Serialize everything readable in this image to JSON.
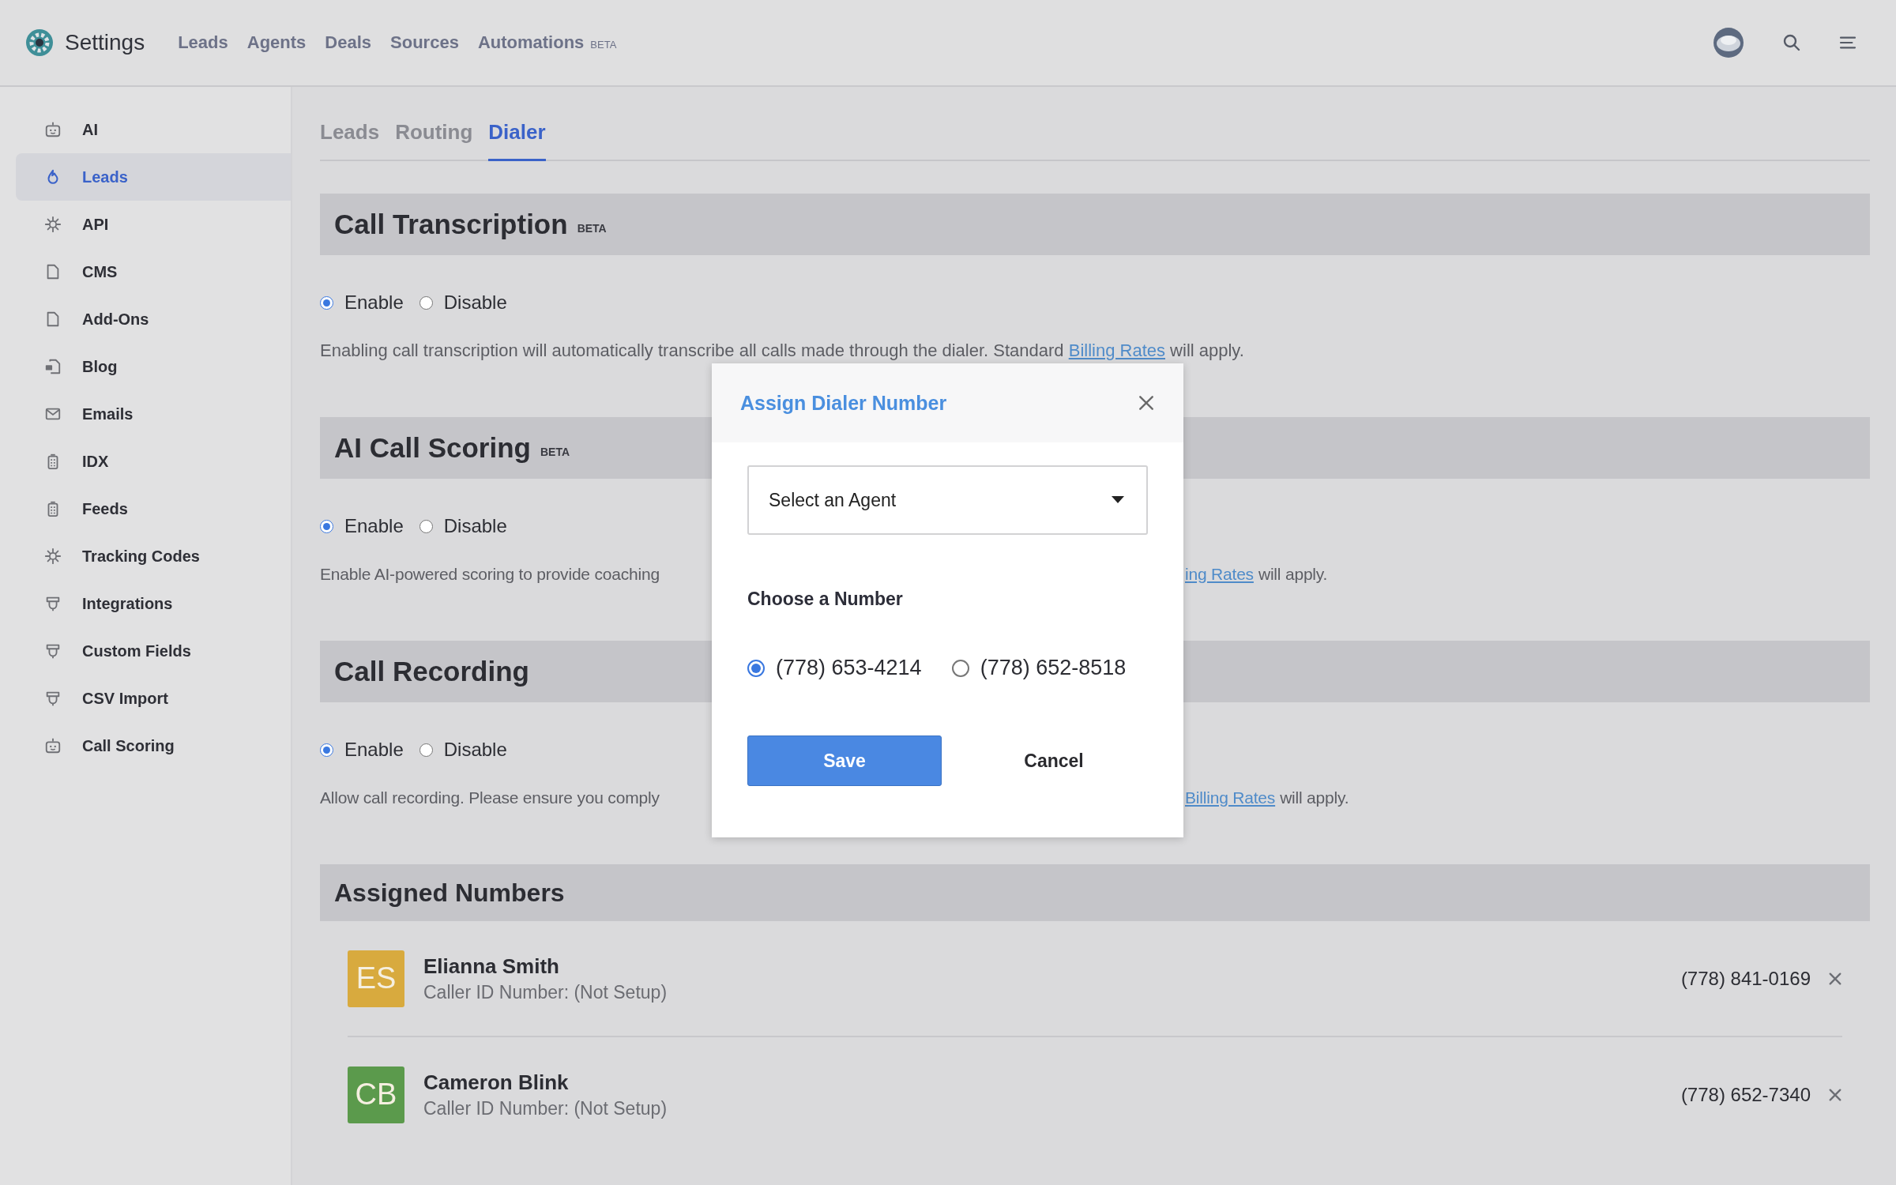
{
  "app": {
    "title": "Settings"
  },
  "nav": [
    {
      "label": "Leads"
    },
    {
      "label": "Agents"
    },
    {
      "label": "Deals"
    },
    {
      "label": "Sources"
    },
    {
      "label": "Automations",
      "badge": "BETA"
    }
  ],
  "sidebar": {
    "items": [
      {
        "label": "AI",
        "kind": "robot",
        "selected": false
      },
      {
        "label": "Leads",
        "kind": "flame",
        "selected": true
      },
      {
        "label": "API",
        "kind": "gear",
        "selected": false
      },
      {
        "label": "CMS",
        "kind": "page",
        "selected": false
      },
      {
        "label": "Add-Ons",
        "kind": "page",
        "selected": false
      },
      {
        "label": "Blog",
        "kind": "chat",
        "selected": false
      },
      {
        "label": "Emails",
        "kind": "mail",
        "selected": false
      },
      {
        "label": "IDX",
        "kind": "building",
        "selected": false
      },
      {
        "label": "Feeds",
        "kind": "building",
        "selected": false
      },
      {
        "label": "Tracking Codes",
        "kind": "gear",
        "selected": false
      },
      {
        "label": "Integrations",
        "kind": "plug",
        "selected": false
      },
      {
        "label": "Custom Fields",
        "kind": "plug",
        "selected": false
      },
      {
        "label": "CSV Import",
        "kind": "plug",
        "selected": false
      },
      {
        "label": "Call Scoring",
        "kind": "robot",
        "selected": false
      }
    ]
  },
  "tabs": [
    {
      "label": "Leads",
      "selected": false
    },
    {
      "label": "Routing",
      "selected": false
    },
    {
      "label": "Dialer",
      "selected": true
    }
  ],
  "sections": [
    {
      "title": "Call Transcription",
      "badge": "BETA",
      "options": [
        {
          "label": "Enable",
          "selected": true
        },
        {
          "label": "Disable",
          "selected": false
        }
      ],
      "description": {
        "kind": "full",
        "before": "Enabling call transcription will automatically transcribe all calls made through the dialer. Standard",
        "link": "Billing Rates",
        "after": "will apply."
      }
    },
    {
      "title": "AI Call Scoring",
      "badge": "BETA",
      "options": [
        {
          "label": "Enable",
          "selected": true
        },
        {
          "label": "Disable",
          "selected": false
        }
      ],
      "description": {
        "kind": "split",
        "before": "Enable AI-powered scoring to provide coaching",
        "link": "ing Rates",
        "after": "will apply."
      }
    },
    {
      "title": "Call Recording",
      "options": [
        {
          "label": "Enable",
          "selected": true
        },
        {
          "label": "Disable",
          "selected": false
        }
      ],
      "description": {
        "kind": "split",
        "before": "Allow call recording. Please ensure you comply",
        "link": "Billing Rates",
        "after": "will apply."
      }
    }
  ],
  "assigned": {
    "title": "Assigned Numbers",
    "rows": [
      {
        "initials": "ES",
        "color": "#d8aa3e",
        "name": "Elianna Smith",
        "caller_id": "Caller ID Number: (Not Setup)",
        "number": "(778) 841-0169"
      },
      {
        "initials": "CB",
        "color": "#5b9a4c",
        "name": "Cameron Blink",
        "caller_id": "Caller ID Number: (Not Setup)",
        "number": "(778) 652-7340"
      }
    ]
  },
  "dialog": {
    "title": "Assign Dialer Number",
    "select": {
      "value": "Select an Agent"
    },
    "choose_label": "Choose a Number",
    "numbers": [
      {
        "label": "(778) 653-4214",
        "selected": true
      },
      {
        "label": "(778) 652-8518",
        "selected": false
      }
    ],
    "save": "Save",
    "cancel": "Cancel"
  }
}
